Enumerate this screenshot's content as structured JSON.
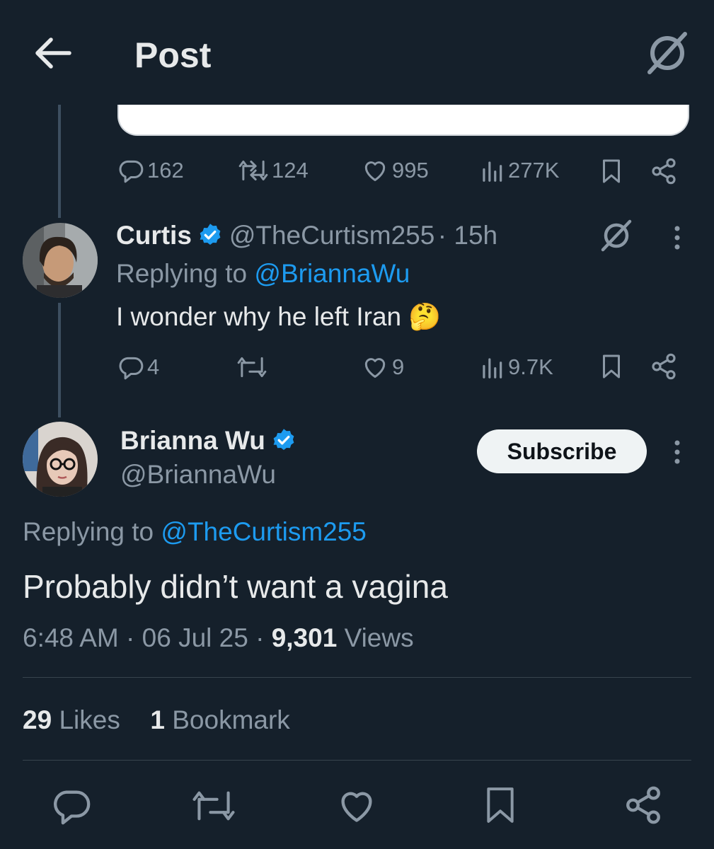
{
  "header": {
    "title": "Post"
  },
  "parent_stats": {
    "replies": "162",
    "reposts": "124",
    "likes": "995",
    "views": "277K"
  },
  "reply": {
    "name": "Curtis",
    "handle": "@TheCurtism255",
    "time": "· 15h",
    "replying_prefix": "Replying to",
    "replying_to": "@BriannaWu",
    "text": "I wonder why he left Iran",
    "emoji": "🤔",
    "stats": {
      "replies": "4",
      "reposts": "",
      "likes": "9",
      "views": "9.7K"
    }
  },
  "main_post": {
    "name": "Brianna Wu",
    "handle": "@BriannaWu",
    "subscribe_label": "Subscribe",
    "replying_prefix": "Replying to",
    "replying_to": "@TheCurtism255",
    "text": "Probably didn’t want a vagina",
    "time": "6:48 AM · 06 Jul 25 ·",
    "views_count": "9,301",
    "views_label": "Views",
    "likes_count": "29",
    "likes_label": "Likes",
    "bookmarks_count": "1",
    "bookmarks_label": "Bookmark"
  },
  "colors": {
    "background": "#15202b",
    "accent": "#1d9bf0",
    "muted": "#8b98a5",
    "text": "#e7e9ea"
  },
  "icons": [
    "back-arrow-icon",
    "grok-icon",
    "reply-icon",
    "repost-icon",
    "like-icon",
    "views-icon",
    "bookmark-icon",
    "share-icon",
    "more-icon",
    "verified-icon"
  ]
}
